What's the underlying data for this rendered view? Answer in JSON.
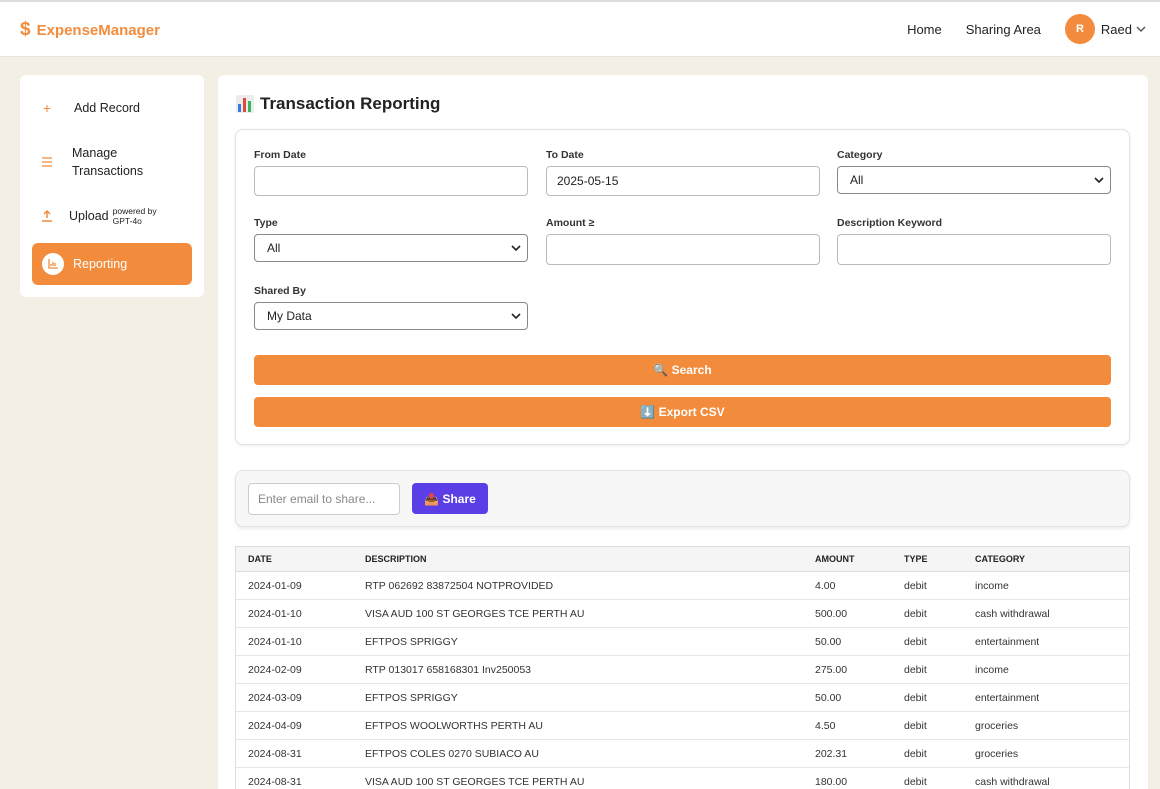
{
  "app": {
    "brand": "ExpenseManager",
    "brand_symbol": "$"
  },
  "nav": {
    "home": "Home",
    "sharing": "Sharing Area",
    "user_initial": "R",
    "user_name": "Raed"
  },
  "sidebar": {
    "items": [
      {
        "label": "Add Record",
        "icon": "plus-icon"
      },
      {
        "label": "Manage Transactions",
        "icon": "list-icon"
      },
      {
        "label": "Upload",
        "icon": "upload-icon",
        "note": "powered by GPT-4o"
      },
      {
        "label": "Reporting",
        "icon": "chart-icon",
        "active": true
      }
    ]
  },
  "page": {
    "title": "Transaction Reporting"
  },
  "filters": {
    "from_date_label": "From Date",
    "from_date_value": "",
    "to_date_label": "To Date",
    "to_date_value": "2025-05-15",
    "category_label": "Category",
    "category_value": "All",
    "type_label": "Type",
    "type_value": "All",
    "amount_label": "Amount ≥",
    "amount_value": "",
    "keyword_label": "Description Keyword",
    "keyword_value": "",
    "shared_by_label": "Shared By",
    "shared_by_value": "My Data",
    "search_button": "🔍 Search",
    "export_button": "⬇️ Export CSV"
  },
  "share": {
    "placeholder": "Enter email to share...",
    "button": "📤 Share"
  },
  "table": {
    "headers": [
      "DATE",
      "DESCRIPTION",
      "AMOUNT",
      "TYPE",
      "CATEGORY"
    ],
    "rows": [
      [
        "2024-01-09",
        "RTP 062692 83872504 NOTPROVIDED",
        "4.00",
        "debit",
        "income"
      ],
      [
        "2024-01-10",
        "VISA AUD 100 ST GEORGES TCE PERTH AU",
        "500.00",
        "debit",
        "cash withdrawal"
      ],
      [
        "2024-01-10",
        "EFTPOS SPRIGGY",
        "50.00",
        "debit",
        "entertainment"
      ],
      [
        "2024-02-09",
        "RTP 013017 658168301 Inv250053",
        "275.00",
        "debit",
        "income"
      ],
      [
        "2024-03-09",
        "EFTPOS SPRIGGY",
        "50.00",
        "debit",
        "entertainment"
      ],
      [
        "2024-04-09",
        "EFTPOS WOOLWORTHS PERTH AU",
        "4.50",
        "debit",
        "groceries"
      ],
      [
        "2024-08-31",
        "EFTPOS COLES 0270 SUBIACO AU",
        "202.31",
        "debit",
        "groceries"
      ],
      [
        "2024-08-31",
        "VISA AUD 100 ST GEORGES TCE PERTH AU",
        "180.00",
        "debit",
        "cash withdrawal"
      ]
    ]
  },
  "colors": {
    "accent": "#f28c3c",
    "share": "#5b3ee6",
    "background": "#f3efe4"
  }
}
